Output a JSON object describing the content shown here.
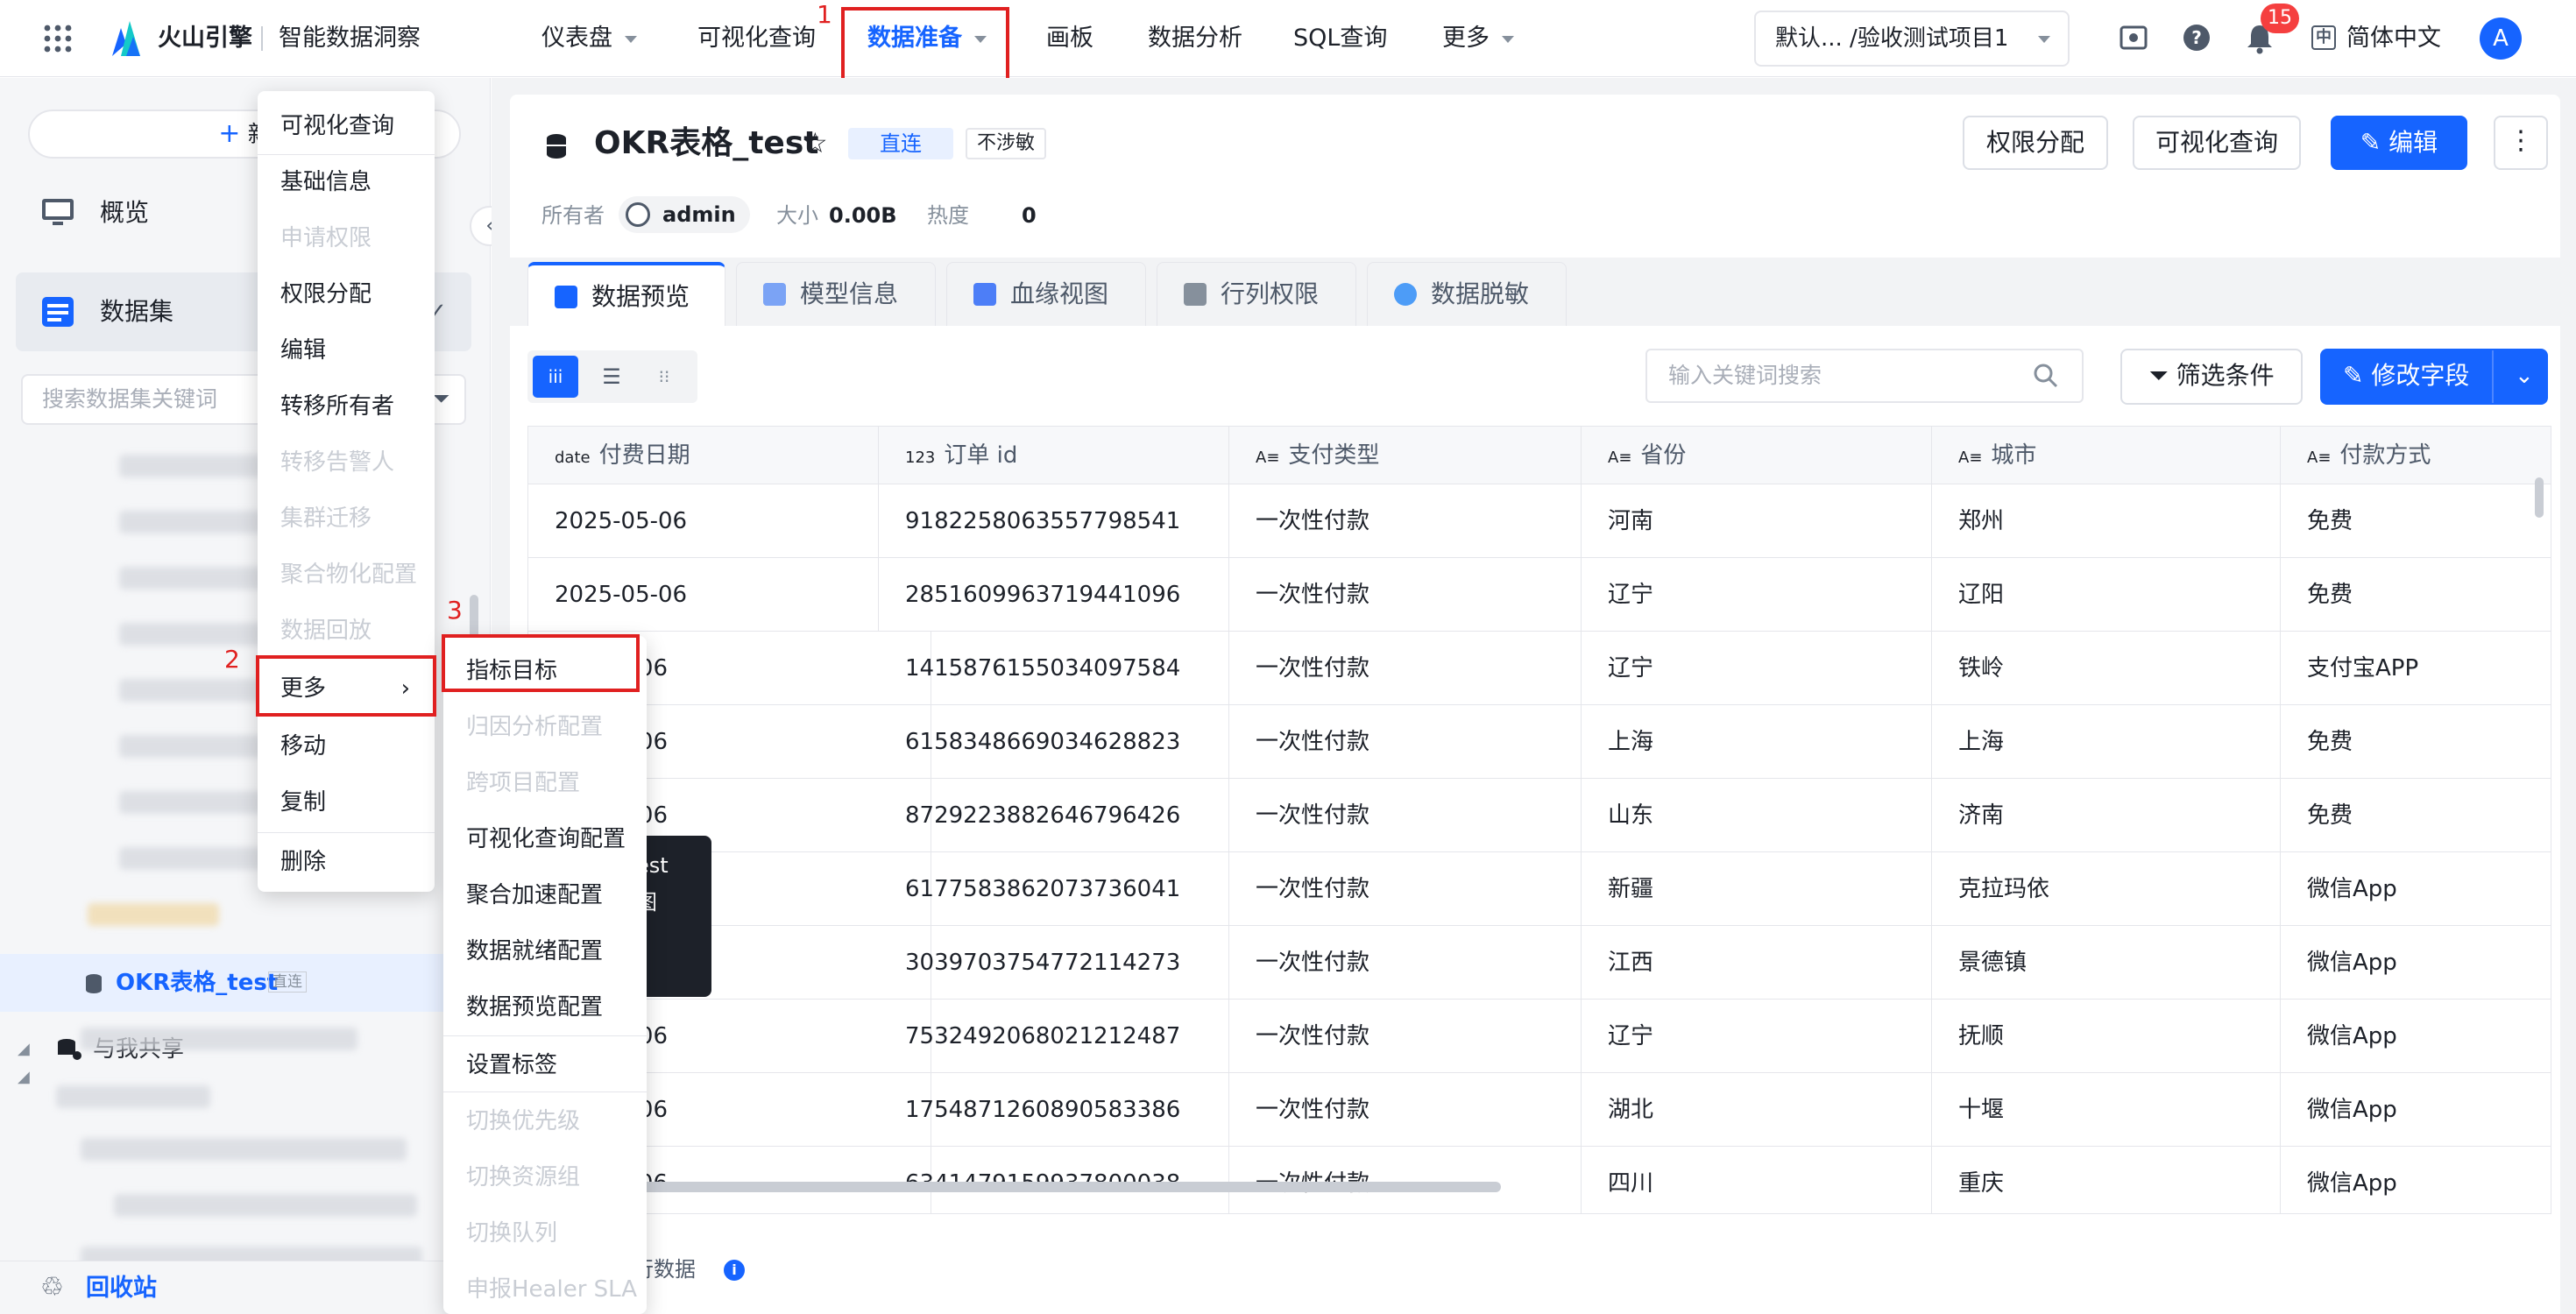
{
  "topbar": {
    "brand": "火山引擎",
    "product": "智能数据洞察",
    "nav": [
      "仪表盘",
      "可视化查询",
      "数据准备",
      "画板",
      "数据分析",
      "SQL查询",
      "更多"
    ],
    "project": "默认...  /验收测试项目1",
    "notify_count": "15",
    "language": "简体中文",
    "avatar": "A"
  },
  "annotations": {
    "n1": "1",
    "n2": "2",
    "n3": "3"
  },
  "sidebar": {
    "new_label": "新",
    "overview": "概览",
    "datasets": "数据集",
    "search_placeholder": "搜索数据集关键词",
    "current_item": "OKR表格_test",
    "current_badge": "直连",
    "shared": "与我共享",
    "recycle": "回收站"
  },
  "dataset": {
    "title": "OKR表格_test",
    "tag_conn": "直连",
    "tag_sens": "不涉敏",
    "owner_label": "所有者",
    "owner": "admin",
    "size_label": "大小",
    "size": "0.00B",
    "heat_label": "热度",
    "heat": "0",
    "btn_perm": "权限分配",
    "btn_query": "可视化查询",
    "btn_edit": "编辑"
  },
  "tabs": [
    "数据预览",
    "模型信息",
    "血缘视图",
    "行列权限",
    "数据脱敏"
  ],
  "toolbar": {
    "search_placeholder": "输入关键词搜索",
    "filter": "筛选条件",
    "modify": "修改字段"
  },
  "table": {
    "columns": [
      {
        "type": "date",
        "label": "付费日期"
      },
      {
        "type": "123",
        "label": "订单 id"
      },
      {
        "type": "A≡",
        "label": "支付类型"
      },
      {
        "type": "A≡",
        "label": "省份"
      },
      {
        "type": "A≡",
        "label": "城市"
      },
      {
        "type": "A≡",
        "label": "付款方式"
      }
    ],
    "rows": [
      [
        "2025-05-06",
        "9182258063557798541",
        "一次性付款",
        "河南",
        "郑州",
        "免费"
      ],
      [
        "2025-05-06",
        "2851609963719441096",
        "一次性付款",
        "辽宁",
        "辽阳",
        "免费"
      ],
      [
        "06",
        "1415876155034097584",
        "一次性付款",
        "辽宁",
        "铁岭",
        "支付宝APP"
      ],
      [
        "06",
        "6158348669034628823",
        "一次性付款",
        "上海",
        "上海",
        "免费"
      ],
      [
        "06",
        "8729223882646796426",
        "一次性付款",
        "山东",
        "济南",
        "免费"
      ],
      [
        "",
        "6177583862073736041",
        "一次性付款",
        "新疆",
        "克拉玛依",
        "微信App"
      ],
      [
        "",
        "3039703754772114273",
        "一次性付款",
        "江西",
        "景德镇",
        "微信App"
      ],
      [
        "06",
        "7532492068021212487",
        "一次性付款",
        "辽宁",
        "抚顺",
        "微信App"
      ],
      [
        "06",
        "1754871260890583386",
        "一次性付款",
        "湖北",
        "十堰",
        "微信App"
      ],
      [
        "06",
        "6341479159937800038",
        "一次性付款",
        "四川",
        "重庆",
        "微信App"
      ]
    ]
  },
  "footer": {
    "text": "行数据"
  },
  "tooltip": {
    "line1": "est",
    "line2": "图"
  },
  "context_menu": {
    "items": [
      {
        "label": "可视化查询",
        "disabled": false
      },
      {
        "label": "基础信息",
        "disabled": false
      },
      {
        "label": "申请权限",
        "disabled": true
      },
      {
        "label": "权限分配",
        "disabled": false
      },
      {
        "label": "编辑",
        "disabled": false
      },
      {
        "label": "转移所有者",
        "disabled": false
      },
      {
        "label": "转移告警人",
        "disabled": true
      },
      {
        "label": "集群迁移",
        "disabled": true
      },
      {
        "label": "聚合物化配置",
        "disabled": true
      },
      {
        "label": "数据回放",
        "disabled": true
      },
      {
        "label": "更多",
        "disabled": false
      },
      {
        "label": "移动",
        "disabled": false
      },
      {
        "label": "复制",
        "disabled": false
      },
      {
        "label": "删除",
        "disabled": false
      }
    ]
  },
  "submenu": {
    "items": [
      {
        "label": "指标目标",
        "disabled": false
      },
      {
        "label": "归因分析配置",
        "disabled": true
      },
      {
        "label": "跨项目配置",
        "disabled": true
      },
      {
        "label": "可视化查询配置",
        "disabled": false
      },
      {
        "label": "聚合加速配置",
        "disabled": false
      },
      {
        "label": "数据就绪配置",
        "disabled": false
      },
      {
        "label": "数据预览配置",
        "disabled": false
      },
      {
        "label": "设置标签",
        "disabled": false
      },
      {
        "label": "切换优先级",
        "disabled": true
      },
      {
        "label": "切换资源组",
        "disabled": true
      },
      {
        "label": "切换队列",
        "disabled": true
      },
      {
        "label": "申报Healer SLA",
        "disabled": true
      }
    ]
  },
  "colors": {
    "accent": "#1664ff",
    "highlight": "#e02020",
    "sidebar_bg": "#f5f6f8"
  }
}
